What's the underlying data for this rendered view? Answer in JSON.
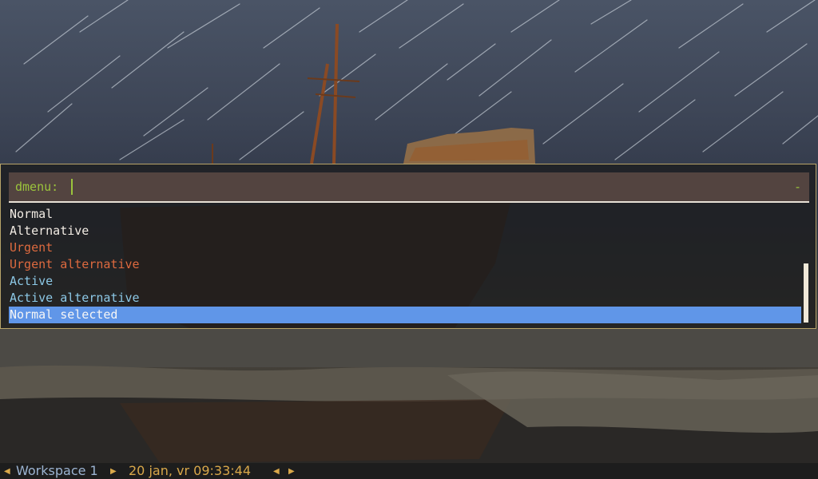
{
  "launcher": {
    "prompt": "dmenu:",
    "input_value": "",
    "indicator": "-",
    "items": [
      {
        "label": "Normal",
        "state": "normal"
      },
      {
        "label": "Alternative",
        "state": "normal"
      },
      {
        "label": "Urgent",
        "state": "urgent"
      },
      {
        "label": "Urgent alternative",
        "state": "urgent"
      },
      {
        "label": "Active",
        "state": "active"
      },
      {
        "label": "Active alternative",
        "state": "active"
      },
      {
        "label": "Normal selected",
        "state": "selected"
      }
    ],
    "colors": {
      "prompt": "#9bc43c",
      "normal": "#f2ece4",
      "urgent": "#de6a3f",
      "active": "#8cc8e6",
      "selected_bg": "#6096e8",
      "border": "#b8a56a"
    }
  },
  "statusbar": {
    "workspace": "Workspace 1",
    "clock": "20 jan, vr 09:33:44",
    "icons": [
      "triangle-left-icon",
      "triangle-right-icon",
      "triangle-left-icon",
      "triangle-right-icon"
    ]
  }
}
